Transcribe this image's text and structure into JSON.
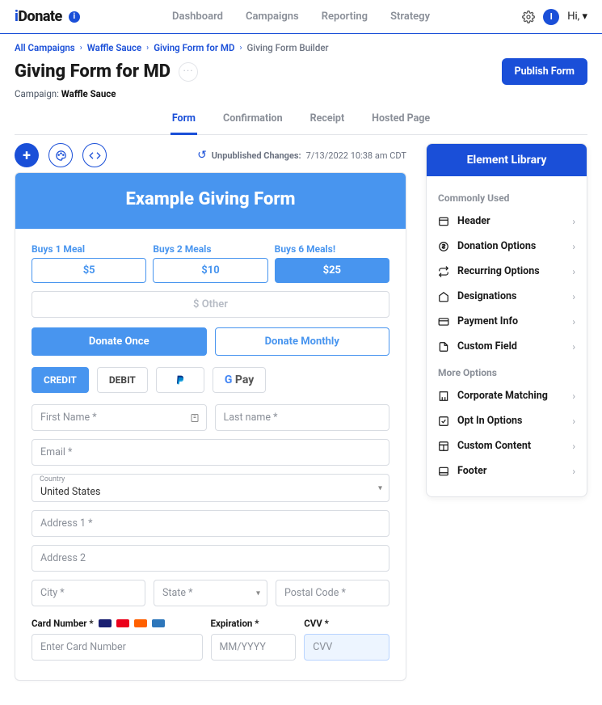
{
  "brand": "Donate",
  "topnav": [
    "Dashboard",
    "Campaigns",
    "Reporting",
    "Strategy"
  ],
  "user": {
    "initial": "I",
    "greeting": "Hi, ▾"
  },
  "breadcrumbs": {
    "items": [
      "All Campaigns",
      "Waffle Sauce",
      "Giving Form for MD"
    ],
    "current": "Giving Form Builder"
  },
  "page": {
    "title": "Giving Form for MD",
    "campaign_label": "Campaign:",
    "campaign_name": "Waffle Sauce",
    "publish_label": "Publish Form"
  },
  "builder_tabs": [
    "Form",
    "Confirmation",
    "Receipt",
    "Hosted Page"
  ],
  "builder_active_tab": 0,
  "status": {
    "label": "Unpublished Changes:",
    "timestamp": "7/13/2022 10:38 am CDT"
  },
  "form": {
    "header_title": "Example Giving Form",
    "options": [
      {
        "label": "Buys 1 Meal",
        "amount": "$5",
        "selected": false
      },
      {
        "label": "Buys 2 Meals",
        "amount": "$10",
        "selected": false
      },
      {
        "label": "Buys 6 Meals!",
        "amount": "$25",
        "selected": true
      }
    ],
    "other_label": "$ Other",
    "frequency": {
      "once": "Donate Once",
      "monthly": "Donate Monthly",
      "selected": "once"
    },
    "pay_methods": {
      "credit": "CREDIT",
      "debit": "DEBIT",
      "selected": "credit"
    },
    "fields": {
      "first_name": "First Name *",
      "last_name": "Last name *",
      "email": "Email *",
      "country_label": "Country",
      "country_value": "United States",
      "address1": "Address 1 *",
      "address2": "Address 2",
      "city": "City *",
      "state": "State *",
      "postal": "Postal Code *"
    },
    "cc": {
      "number_label": "Card Number *",
      "number_ph": "Enter Card Number",
      "exp_label": "Expiration *",
      "exp_ph": "MM/YYYY",
      "cvv_label": "CVV *",
      "cvv_ph": "CVV"
    }
  },
  "library": {
    "title": "Element Library",
    "group1_title": "Commonly Used",
    "group1": [
      "Header",
      "Donation Options",
      "Recurring Options",
      "Designations",
      "Payment Info",
      "Custom Field"
    ],
    "group2_title": "More Options",
    "group2": [
      "Corporate Matching",
      "Opt In Options",
      "Custom Content",
      "Footer"
    ]
  }
}
